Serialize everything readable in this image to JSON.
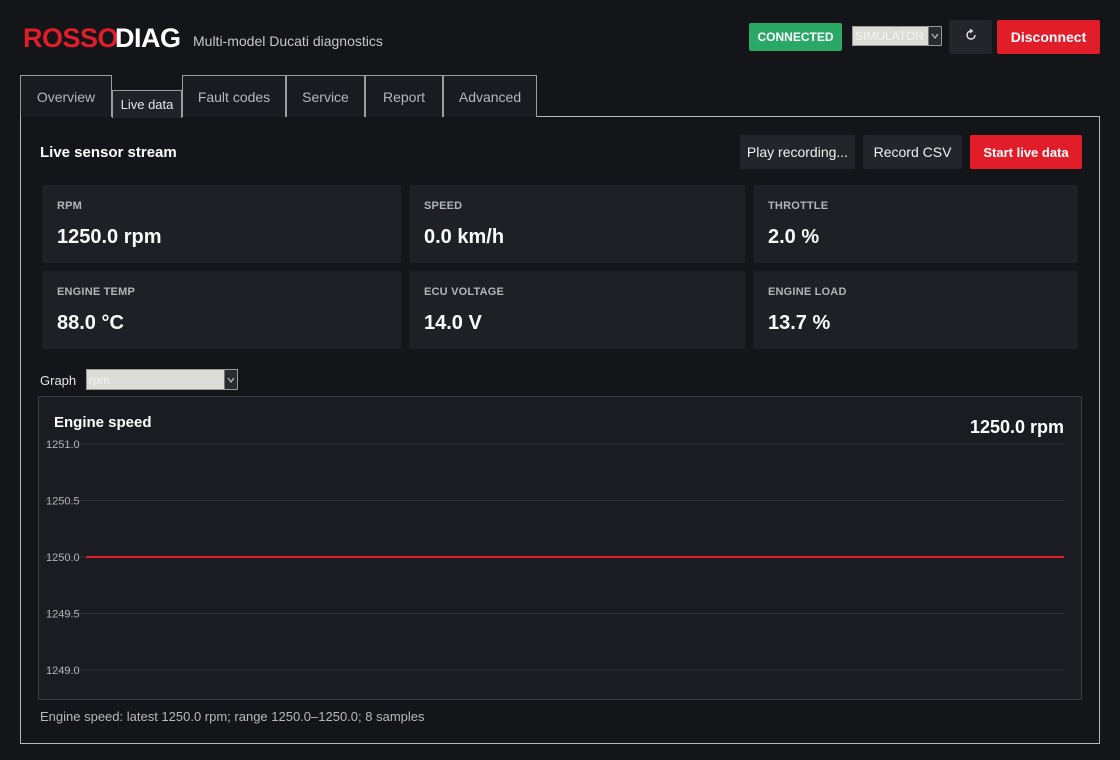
{
  "brand": {
    "part1": "ROSSO",
    "part2": "DIAG",
    "subtitle": "Multi-model Ducati diagnostics"
  },
  "header": {
    "status_badge": "CONNECTED",
    "mode_select_value": "SIMULATOR",
    "refresh_icon": "refresh-icon",
    "disconnect_label": "Disconnect"
  },
  "tabs": [
    {
      "label": "Overview",
      "active": false
    },
    {
      "label": "Live data",
      "active": true
    },
    {
      "label": "Fault codes",
      "active": false
    },
    {
      "label": "Service",
      "active": false
    },
    {
      "label": "Report",
      "active": false
    },
    {
      "label": "Advanced",
      "active": false
    }
  ],
  "live": {
    "title": "Live sensor stream",
    "play_label": "Play recording...",
    "record_label": "Record CSV",
    "start_label": "Start live data",
    "metrics": [
      {
        "label": "RPM",
        "value": "1250.0 rpm"
      },
      {
        "label": "SPEED",
        "value": "0.0 km/h"
      },
      {
        "label": "THROTTLE",
        "value": "2.0 %"
      },
      {
        "label": "ENGINE TEMP",
        "value": "88.0 °C"
      },
      {
        "label": "ECU VOLTAGE",
        "value": "14.0 V"
      },
      {
        "label": "ENGINE LOAD",
        "value": "13.7 %"
      }
    ],
    "graph_label": "Graph",
    "graph_select_value": "rpm",
    "summary": "Engine speed: latest 1250.0 rpm; range 1250.0–1250.0; 8 samples"
  },
  "colors": {
    "accent": "#e11d2a",
    "connected": "#2aa866",
    "card": "#1e2026",
    "background": "#141519"
  },
  "chart_data": {
    "type": "line",
    "title": "Engine speed",
    "latest_label": "1250.0 rpm",
    "ylim": [
      1249.0,
      1251.0
    ],
    "yticks": [
      "1251.0",
      "1250.5",
      "1250.0",
      "1249.5",
      "1249.0"
    ],
    "ytick_values": [
      1251.0,
      1250.5,
      1250.0,
      1249.5,
      1249.0
    ],
    "grid": true,
    "series": [
      {
        "color": "#e11d2a",
        "values": [
          1250.0,
          1250.0,
          1250.0,
          1250.0,
          1250.0,
          1250.0,
          1250.0,
          1250.0
        ]
      }
    ]
  }
}
